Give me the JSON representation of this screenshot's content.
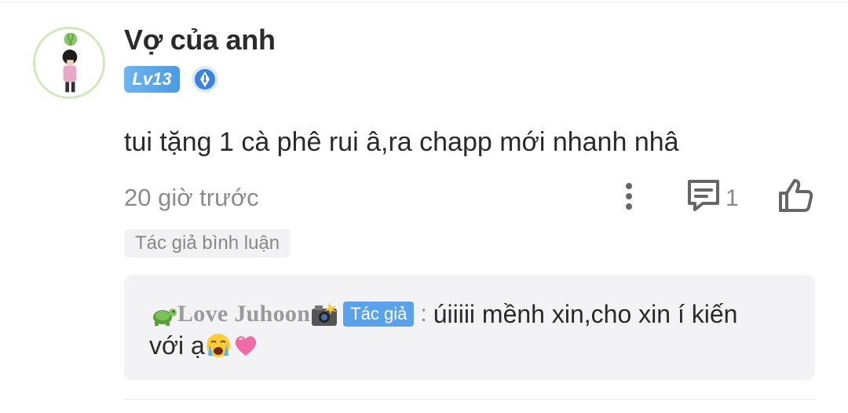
{
  "comment": {
    "username": "Vợ của anh",
    "level_badge": "Lv13",
    "text": "tui tặng 1 cà phê rui â,ra chapp mới nhanh nhâ",
    "time": "20 giờ trước",
    "reply_count": "1",
    "author_tag": "Tác giả bình luận"
  },
  "reply": {
    "name": "Love Juhoon",
    "role_tag": "Tác giả",
    "separator": ":",
    "text_line1": "úiiiii mềnh xin,cho xin í kiến",
    "text_line2": "với ạ"
  },
  "icons": {
    "more": "more-vertical-icon",
    "reply": "comment-icon",
    "like": "thumbs-up-icon",
    "pen_badge": "pen-badge-icon"
  },
  "colors": {
    "level_badge": "#4a9be3",
    "author_tag_bg": "#f2f2f4",
    "reply_box_bg": "#f3f3f5",
    "role_tag_bg": "#5aa3ea"
  }
}
